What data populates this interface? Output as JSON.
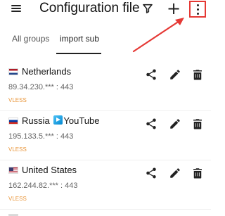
{
  "app": {
    "title": "Configuration file"
  },
  "toolbar": {
    "menu_icon": "hamburger-menu-icon",
    "filter_icon": "filter-icon",
    "add_icon": "plus-icon",
    "add_label": "+",
    "more_icon": "more-vert-icon",
    "highlight_color": "#e53935"
  },
  "tabs": [
    {
      "label": "All groups",
      "selected": false
    },
    {
      "label": "import sub",
      "selected": true
    }
  ],
  "servers": [
    {
      "flag": "netherlands-flag",
      "name": "Netherlands",
      "address": "89.34.230.*** : 443",
      "protocol": "VLESS"
    },
    {
      "flag": "russia-flag",
      "name_prefix": "Russia",
      "name_suffix": "YouTube",
      "address": "195.133.5.*** : 443",
      "protocol": "VLESS"
    },
    {
      "flag": "usa-flag",
      "name": "United States",
      "address": "162.244.82.*** : 443",
      "protocol": "VLESS"
    }
  ],
  "colors": {
    "protocol": "#e9963c",
    "annotation": "#e53935"
  }
}
